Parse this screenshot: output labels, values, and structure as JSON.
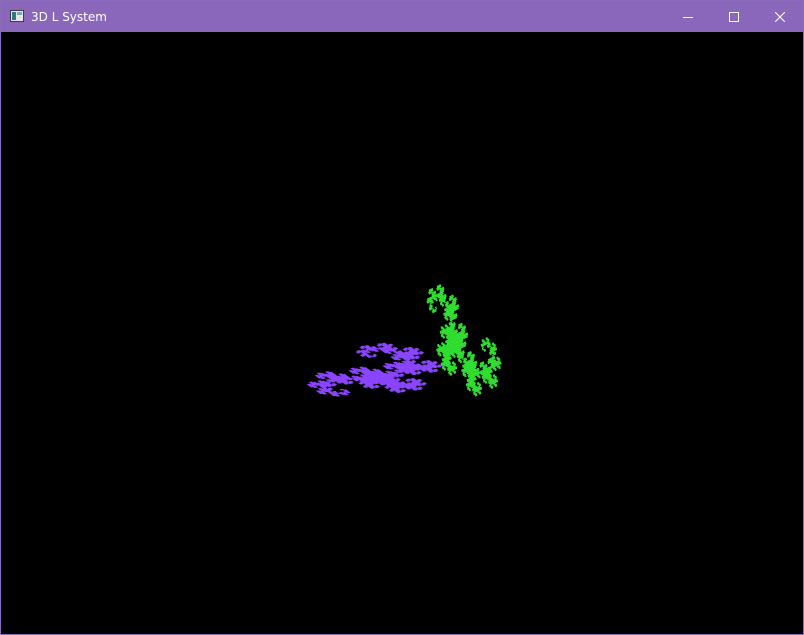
{
  "window": {
    "title": "3D L System",
    "icons": {
      "app": "console-window-icon",
      "minimize": "minimize-icon",
      "maximize": "maximize-icon",
      "close": "close-icon"
    }
  },
  "colors": {
    "titlebar": "#8a67bb",
    "background": "#000000",
    "curve_primary": "#8c45ff",
    "curve_secondary": "#32e632"
  },
  "scene": {
    "curve": "dragon",
    "iterations": 11,
    "copies": 2
  }
}
